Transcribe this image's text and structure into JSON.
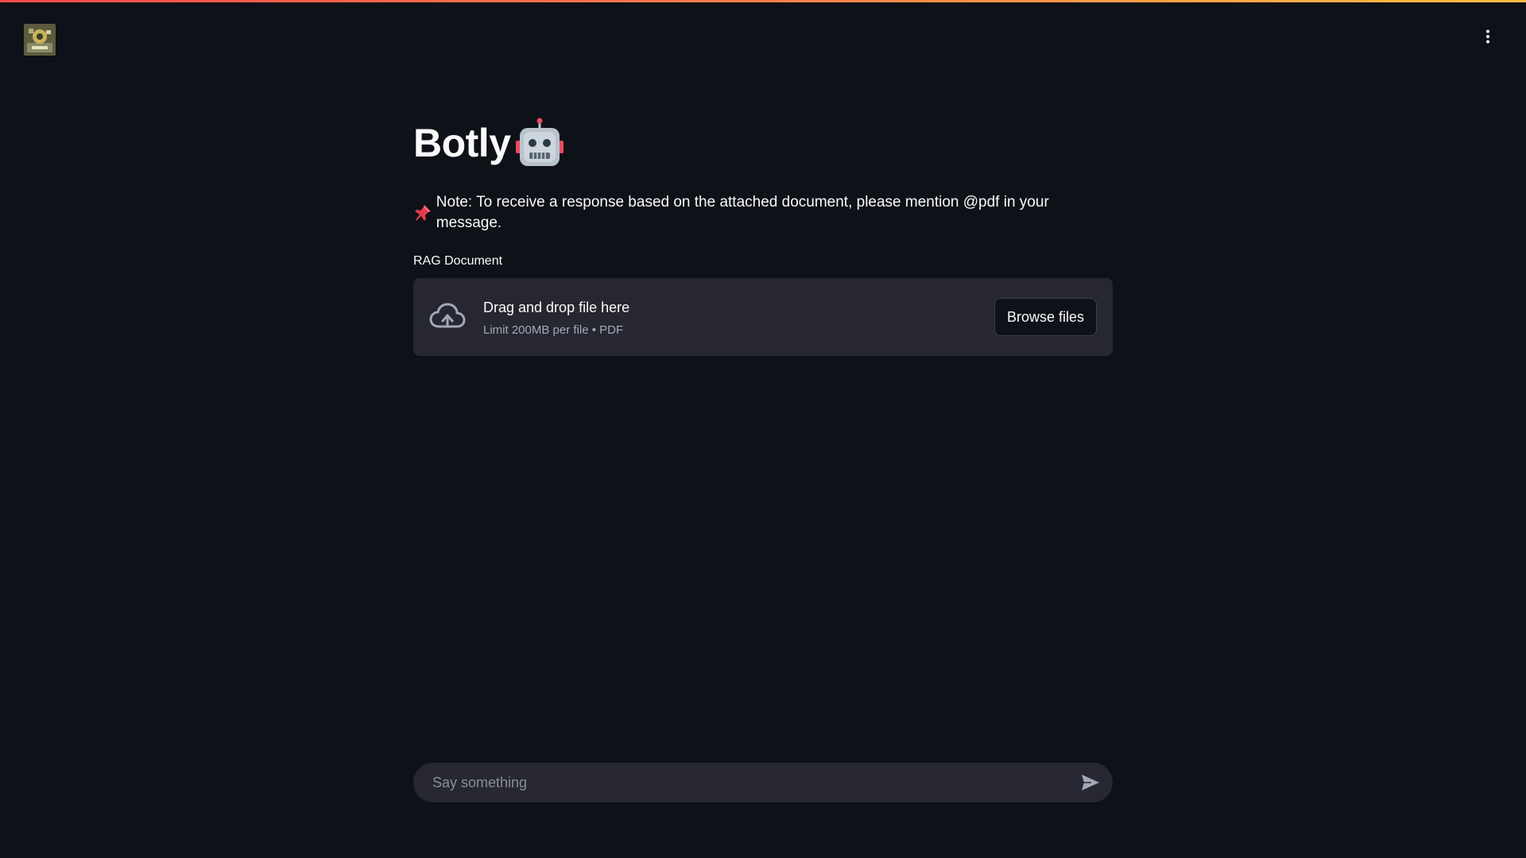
{
  "header": {
    "logo_icon": "app-logo-image",
    "menu_icon": "vertical-ellipsis-icon",
    "decoration_colors": [
      "#ff4b4b",
      "#ffbd45"
    ]
  },
  "main": {
    "title": "Botly",
    "title_emoji_icon": "robot-face-icon",
    "note_icon": "pushpin-icon",
    "note_text": "Note: To receive a response based on the attached document, please mention @pdf in your message."
  },
  "uploader": {
    "label": "RAG Document",
    "icon": "cloud-upload-icon",
    "instructions": "Drag and drop file here",
    "limit_text": "Limit 200MB per file • PDF",
    "browse_label": "Browse files"
  },
  "chat": {
    "placeholder": "Say something",
    "value": "",
    "send_icon": "send-icon"
  },
  "colors": {
    "background": "#0e1117",
    "surface": "#262730",
    "text": "#fafafa",
    "muted": "#a3a8b8"
  }
}
